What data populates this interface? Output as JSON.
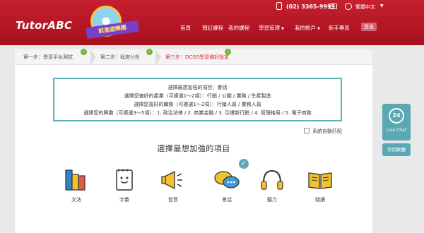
{
  "header": {
    "logo": "TutorABC",
    "badge_text": "前進遊樂園",
    "phone": "(02) 3365-9999",
    "language": "繁體中文",
    "nav": [
      "首頁",
      "預訂課程",
      "我的課程",
      "學習管理",
      "我的帳戶",
      "新手專區"
    ],
    "logout": "登出"
  },
  "steps": [
    {
      "label": "第一步：學習平台測試",
      "done": true
    },
    {
      "label": "第二步：程度分析",
      "done": true
    },
    {
      "label": "第三步：DCGS學習偏好設定",
      "done": true
    }
  ],
  "summary": {
    "lines": [
      "選擇最想加強的項目：會話",
      "選擇您偏好的產業（可複選1～2項）：行銷 / 公關 / 業務 / 生產製造",
      "選擇您喜好的職務（可複選1～2項）：行銷人員 / 業務人員",
      "選擇您的興趣（可複選3～5項）：1. 政治法律 / 2. 商業金融 / 3. 引爆新行銷 / 4. 管理格局 / 5. 電子商務"
    ]
  },
  "auto_match": "系統自動匹配",
  "section_title": "選擇最想加強的項目",
  "options": [
    {
      "label": "文法",
      "icon": "books-icon"
    },
    {
      "label": "字彙",
      "icon": "notebook-icon"
    },
    {
      "label": "發音",
      "icon": "megaphone-icon"
    },
    {
      "label": "會話",
      "icon": "chat-bubbles-icon",
      "selected": true
    },
    {
      "label": "聽力",
      "icon": "headphones-icon"
    },
    {
      "label": "閱讀",
      "icon": "open-book-icon"
    }
  ],
  "sidebar": {
    "live_chat_number": "24",
    "live_chat": "Live Chat",
    "faq": "常用軟體"
  },
  "colors": {
    "header": "#b8141f",
    "accent": "#5aa8b4",
    "active_step": "#d62e3d",
    "done": "#74b52f"
  }
}
